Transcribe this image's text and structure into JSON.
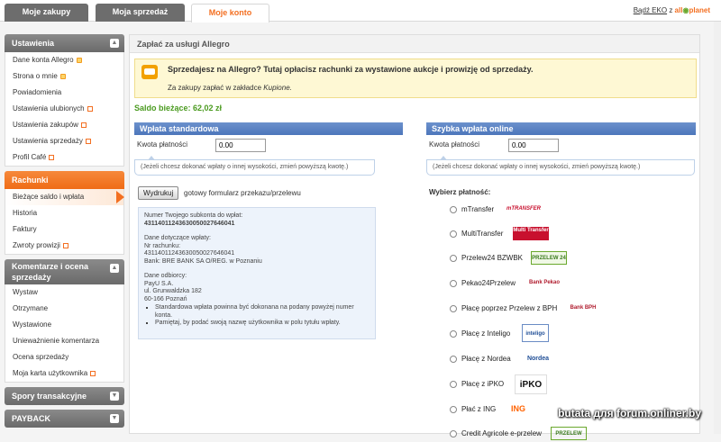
{
  "tabs": [
    {
      "label": "Moje zakupy",
      "active": false
    },
    {
      "label": "Moja sprzedaż",
      "active": false
    },
    {
      "label": "Moje konto",
      "active": true
    }
  ],
  "header_link": {
    "prefix": "Bądź EKO",
    "mid": "z",
    "brand1": "all",
    "brand2": "planet"
  },
  "sidebar": {
    "ustawienia": {
      "title": "Ustawienia",
      "items": [
        "Dane konta Allegro",
        "Strona o mnie",
        "Powiadomienia",
        "Ustawienia ulubionych",
        "Ustawienia zakupów",
        "Ustawienia sprzedaży",
        "Profil Café"
      ]
    },
    "rachunki": {
      "title": "Rachunki",
      "items": [
        "Bieżące saldo i wpłata",
        "Historia",
        "Faktury",
        "Zwroty prowizji"
      ]
    },
    "komentarze": {
      "title": "Komentarze i ocena sprzedaży",
      "items": [
        "Wystaw",
        "Otrzymane",
        "Wystawione",
        "Unieważnienie komentarza",
        "Ocena sprzedaży",
        "Moja karta użytkownika"
      ]
    },
    "spory": {
      "title": "Spory transakcyjne"
    },
    "payback": {
      "title": "PAYBACK"
    }
  },
  "main": {
    "title": "Zapłać za usługi Allegro",
    "notice_line1": "Sprzedajesz na Allegro? Tutaj opłacisz rachunki za wystawione aukcje i prowizję od sprzedaży.",
    "notice_line2_prefix": "Za zakupy zapłać w zakładce",
    "notice_line2_link": "Kupione.",
    "saldo": "Saldo bieżące: 62,02 zł"
  },
  "standard": {
    "title": "Wpłata standardowa",
    "kwota_label": "Kwota płatności",
    "kwota_value": "0.00",
    "hint": "(Jeżeli chcesz dokonać wpłaty o innej wysokości, zmień powyższą kwotę.)",
    "print_button": "Wydrukuj",
    "print_note": "gotowy formularz przekazu/przelewu",
    "info": {
      "subaccount_label": "Numer Twojego subkonta do wpłat:",
      "subaccount": "43114011243630050027646041",
      "payer_label": "Dane dotyczące wpłaty:",
      "account_label": "Nr rachunku:",
      "account": "43114011243630050027646041",
      "bank": "Bank: BRE BANK SA O/REG. w Poznaniu",
      "recipient_label": "Dane odbiorcy:",
      "recipient_name": "PayU S.A.",
      "recipient_street": "ul. Grunwaldzka 182",
      "recipient_city": "60-166 Poznań",
      "bullets": [
        "Standardowa wpłata powinna być dokonana na podany powyżej numer konta.",
        "Pamiętaj, by podać swoją nazwę użytkownika w polu tytułu wpłaty."
      ]
    }
  },
  "online": {
    "title": "Szybka wpłata online",
    "kwota_label": "Kwota płatności",
    "kwota_value": "0.00",
    "hint": "(Jeżeli chcesz dokonać wpłaty o innej wysokości, zmień powyższą kwotę.)",
    "choose_label": "Wybierz płatność:",
    "methods": [
      {
        "name": "mTransfer",
        "logo": "mTRANSFER"
      },
      {
        "name": "MultiTransfer",
        "logo": "Multi Transfer"
      },
      {
        "name": "Przelew24 BZWBK",
        "logo": "PRZELEW 24"
      },
      {
        "name": "Pekao24Przelew",
        "logo": "Bank Pekao"
      },
      {
        "name": "Płacę poprzez Przelew z BPH",
        "logo": "Bank BPH"
      },
      {
        "name": "Płacę z Inteligo",
        "logo": "inteligo"
      },
      {
        "name": "Płacę z Nordea",
        "logo": "Nordea"
      },
      {
        "name": "Płacę z iPKO",
        "logo": "iPKO"
      },
      {
        "name": "Płać z ING",
        "logo": "ING"
      },
      {
        "name": "Credit Agricole e-przelew",
        "logo": "PRZELEW"
      }
    ]
  },
  "watermark": "butata для forum.onliner.by"
}
